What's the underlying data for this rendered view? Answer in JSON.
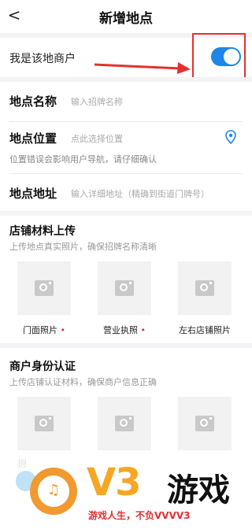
{
  "header": {
    "back": "<",
    "title": "新增地点"
  },
  "merchant": {
    "label": "我是该地商户",
    "enabled": true
  },
  "fields": {
    "name": {
      "label": "地点名称",
      "placeholder": "输入招牌名称"
    },
    "location": {
      "label": "地点位置",
      "placeholder": "点此选择位置",
      "hint": "位置错误会影响用户导航，请仔细确认"
    },
    "address": {
      "label": "地点地址",
      "placeholder": "输入详细地址（精确到街道门牌号）"
    }
  },
  "store_materials": {
    "title": "店铺材料上传",
    "subtitle": "上传地点真实照片，确保招牌名称清晰",
    "photos": [
      {
        "label": "门面照片",
        "required": "•"
      },
      {
        "label": "营业执照",
        "required": "•"
      },
      {
        "label": "左右店铺照片",
        "required": ""
      }
    ]
  },
  "merchant_auth": {
    "title": "商户身份认证",
    "subtitle": "上传店铺认证材料，确保商户信息正确",
    "cut_label": "抈"
  },
  "watermark": {
    "brand": "V3",
    "brand2": "游戏",
    "slogan": "游戏人生，不负VVVV3"
  },
  "colors": {
    "accent": "#1f86e8",
    "highlight": "#e53030"
  }
}
